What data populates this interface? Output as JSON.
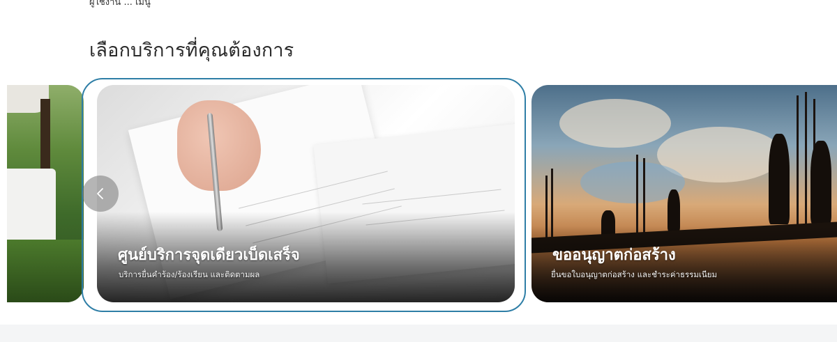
{
  "top_partial_text": "ผู้ใช้งาน ... เมนู",
  "section": {
    "heading": "เลือกบริการที่คุณต้องการ"
  },
  "carousel": {
    "prev_icon": "chevron-left-icon",
    "cards": [
      {
        "title": "",
        "subtitle": ""
      },
      {
        "title": "ศูนย์บริการจุดเดียวเบ็ดเสร็จ",
        "subtitle": "บริการยื่นคำร้อง/ร้องเรียน และติดตามผล"
      },
      {
        "title": "ขออนุญาตก่อสร้าง",
        "subtitle": "ยื่นขอใบอนุญาตก่อสร้าง และชำระค่าธรรมเนียม"
      }
    ]
  },
  "colors": {
    "active_outline": "#2e7ea6",
    "heading_text": "#2b2b2b"
  }
}
